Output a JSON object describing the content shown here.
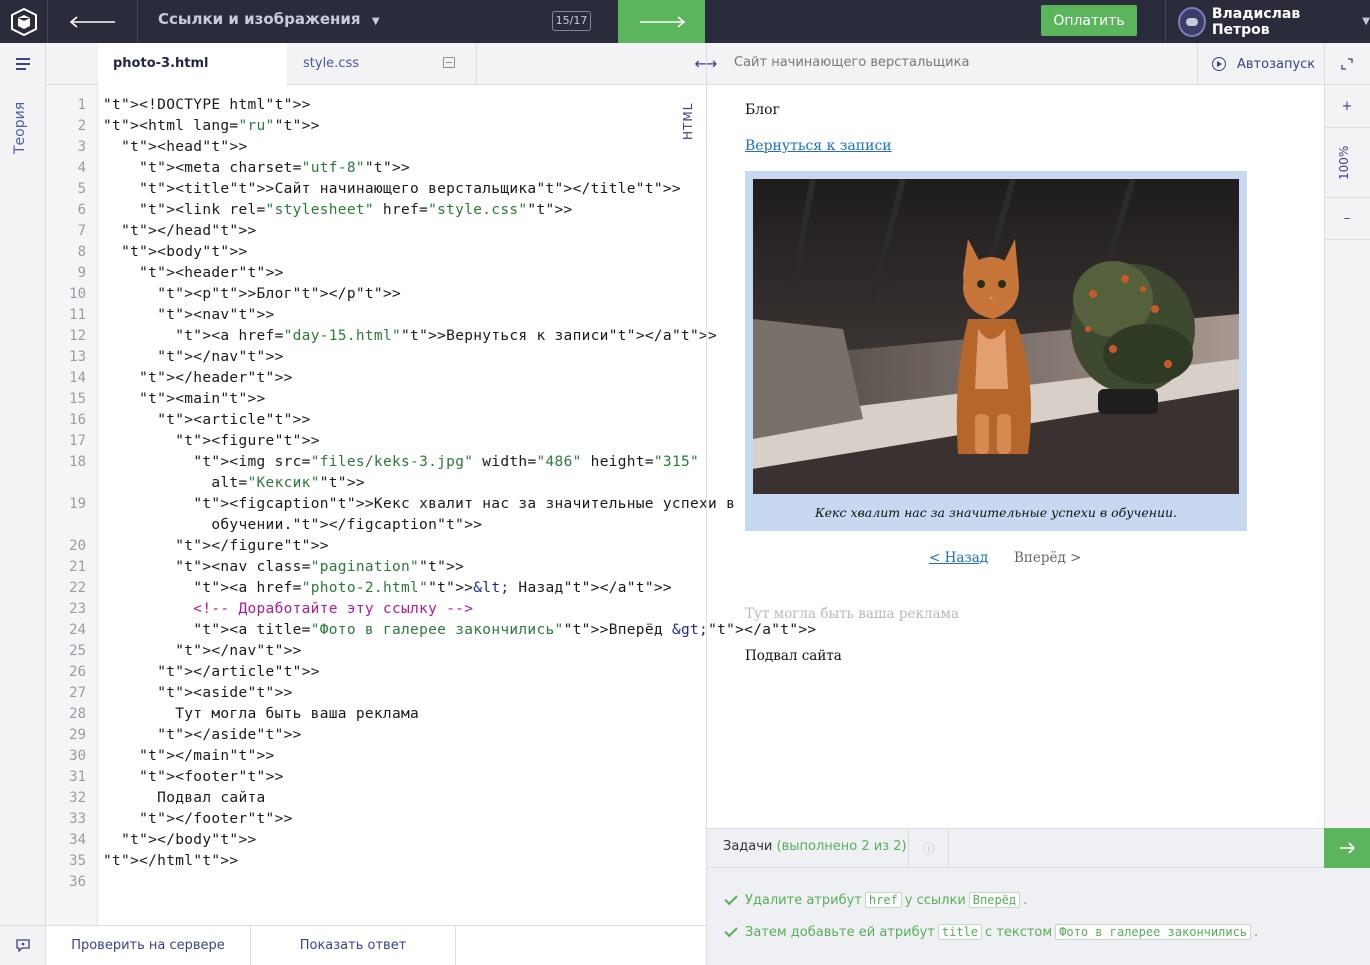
{
  "topbar": {
    "lesson_title": "Ссылки и изображения",
    "counter": "15/17",
    "pay_label": "Оплатить",
    "user_name": "Владислав Петров"
  },
  "sidebar": {
    "theory_label": "Теория"
  },
  "editor": {
    "tabs": [
      {
        "label": "photo-3.html"
      },
      {
        "label": "style.css"
      }
    ],
    "mode_label": "HTML",
    "line_numbers": [
      "1",
      "2",
      "3",
      "4",
      "5",
      "6",
      "7",
      "8",
      "9",
      "10",
      "11",
      "12",
      "13",
      "14",
      "15",
      "16",
      "17",
      "18",
      "19",
      "20",
      "21",
      "22",
      "23",
      "24",
      "25",
      "26",
      "27",
      "28",
      "29",
      "30",
      "31",
      "32",
      "33",
      "34",
      "35",
      "36"
    ],
    "lines": [
      "<!DOCTYPE html>",
      "<html lang=\"ru\">",
      "  <head>",
      "    <meta charset=\"utf-8\">",
      "    <title>Сайт начинающего верстальщика</title>",
      "    <link rel=\"stylesheet\" href=\"style.css\">",
      "  </head>",
      "  <body>",
      "    <header>",
      "      <p>Блог</p>",
      "      <nav>",
      "        <a href=\"day-15.html\">Вернуться к записи</a>",
      "      </nav>",
      "    </header>",
      "    <main>",
      "      <article>",
      "        <figure>",
      "          <img src=\"files/keks-3.jpg\" width=\"486\" height=\"315\"",
      "            alt=\"Кексик\">",
      "          <figcaption>Кекс хвалит нас за значительные успехи в",
      "            обучении.</figcaption>",
      "        </figure>",
      "        <nav class=\"pagination\">",
      "          <a href=\"photo-2.html\">&lt; Назад</a>",
      "          <!-- Доработайте эту ссылку -->",
      "          <a title=\"Фото в галерее закончились\">Вперёд &gt;</a>",
      "        </nav>",
      "      </article>",
      "      <aside>",
      "        Тут могла быть ваша реклама",
      "      </aside>",
      "    </main>",
      "    <footer>",
      "      Подвал сайта",
      "    </footer>",
      "  </body>",
      "</html>",
      ""
    ],
    "check_label": "Проверить на сервере",
    "answer_label": "Показать ответ"
  },
  "preview": {
    "title": "Сайт начинающего верстальщика",
    "autorun_label": "Автозапуск",
    "zoom": "100%",
    "zoom_in": "+",
    "zoom_out": "–",
    "blog": "Блог",
    "back_link": "Вернуться к записи",
    "caption": "Кекс хвалит нас за значительные успехи в обучении.",
    "prev_link": "< Назад",
    "next_link": "Вперёд >",
    "ad": "Тут могла быть ваша реклама",
    "footer": "Подвал сайта"
  },
  "tasks": {
    "label": "Задачи",
    "done": "(выполнено 2 из 2)",
    "items": [
      {
        "t1": "Удалите атрибут",
        "c1": "href",
        "t2": "у ссылки",
        "c2": "Вперёд",
        "t3": "."
      },
      {
        "t1": "Затем добавьте ей атрибут",
        "c1": "title",
        "t2": "с текстом",
        "c2": "Фото в галерее закончились",
        "t3": "."
      }
    ]
  },
  "colors": {
    "accent": "#5bb55a",
    "topbar": "#2a2c3c",
    "link": "#3b428c"
  }
}
